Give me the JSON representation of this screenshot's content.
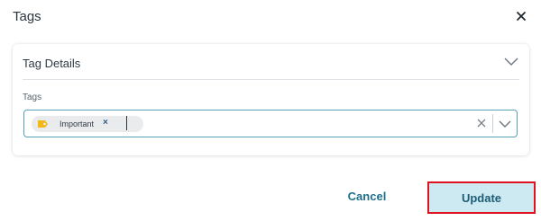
{
  "dialog": {
    "title": "Tags",
    "close_icon": "close-icon"
  },
  "card": {
    "title": "Tag Details",
    "expand_icon": "chevron-up-icon",
    "field_label": "Tags",
    "tags": [
      {
        "label": "Important",
        "icon": "tag-icon",
        "icon_color": "#f2b81a",
        "remove_label": "×"
      }
    ],
    "input_value": "",
    "clear_icon": "clear-icon",
    "dropdown_icon": "chevron-down-icon"
  },
  "buttons": {
    "cancel_label": "Cancel",
    "update_label": "Update"
  },
  "colors": {
    "accent": "#1e6e8c",
    "update_bg": "#cde9f2",
    "highlight_border": "#e0121f",
    "input_border": "#57a0b5"
  }
}
